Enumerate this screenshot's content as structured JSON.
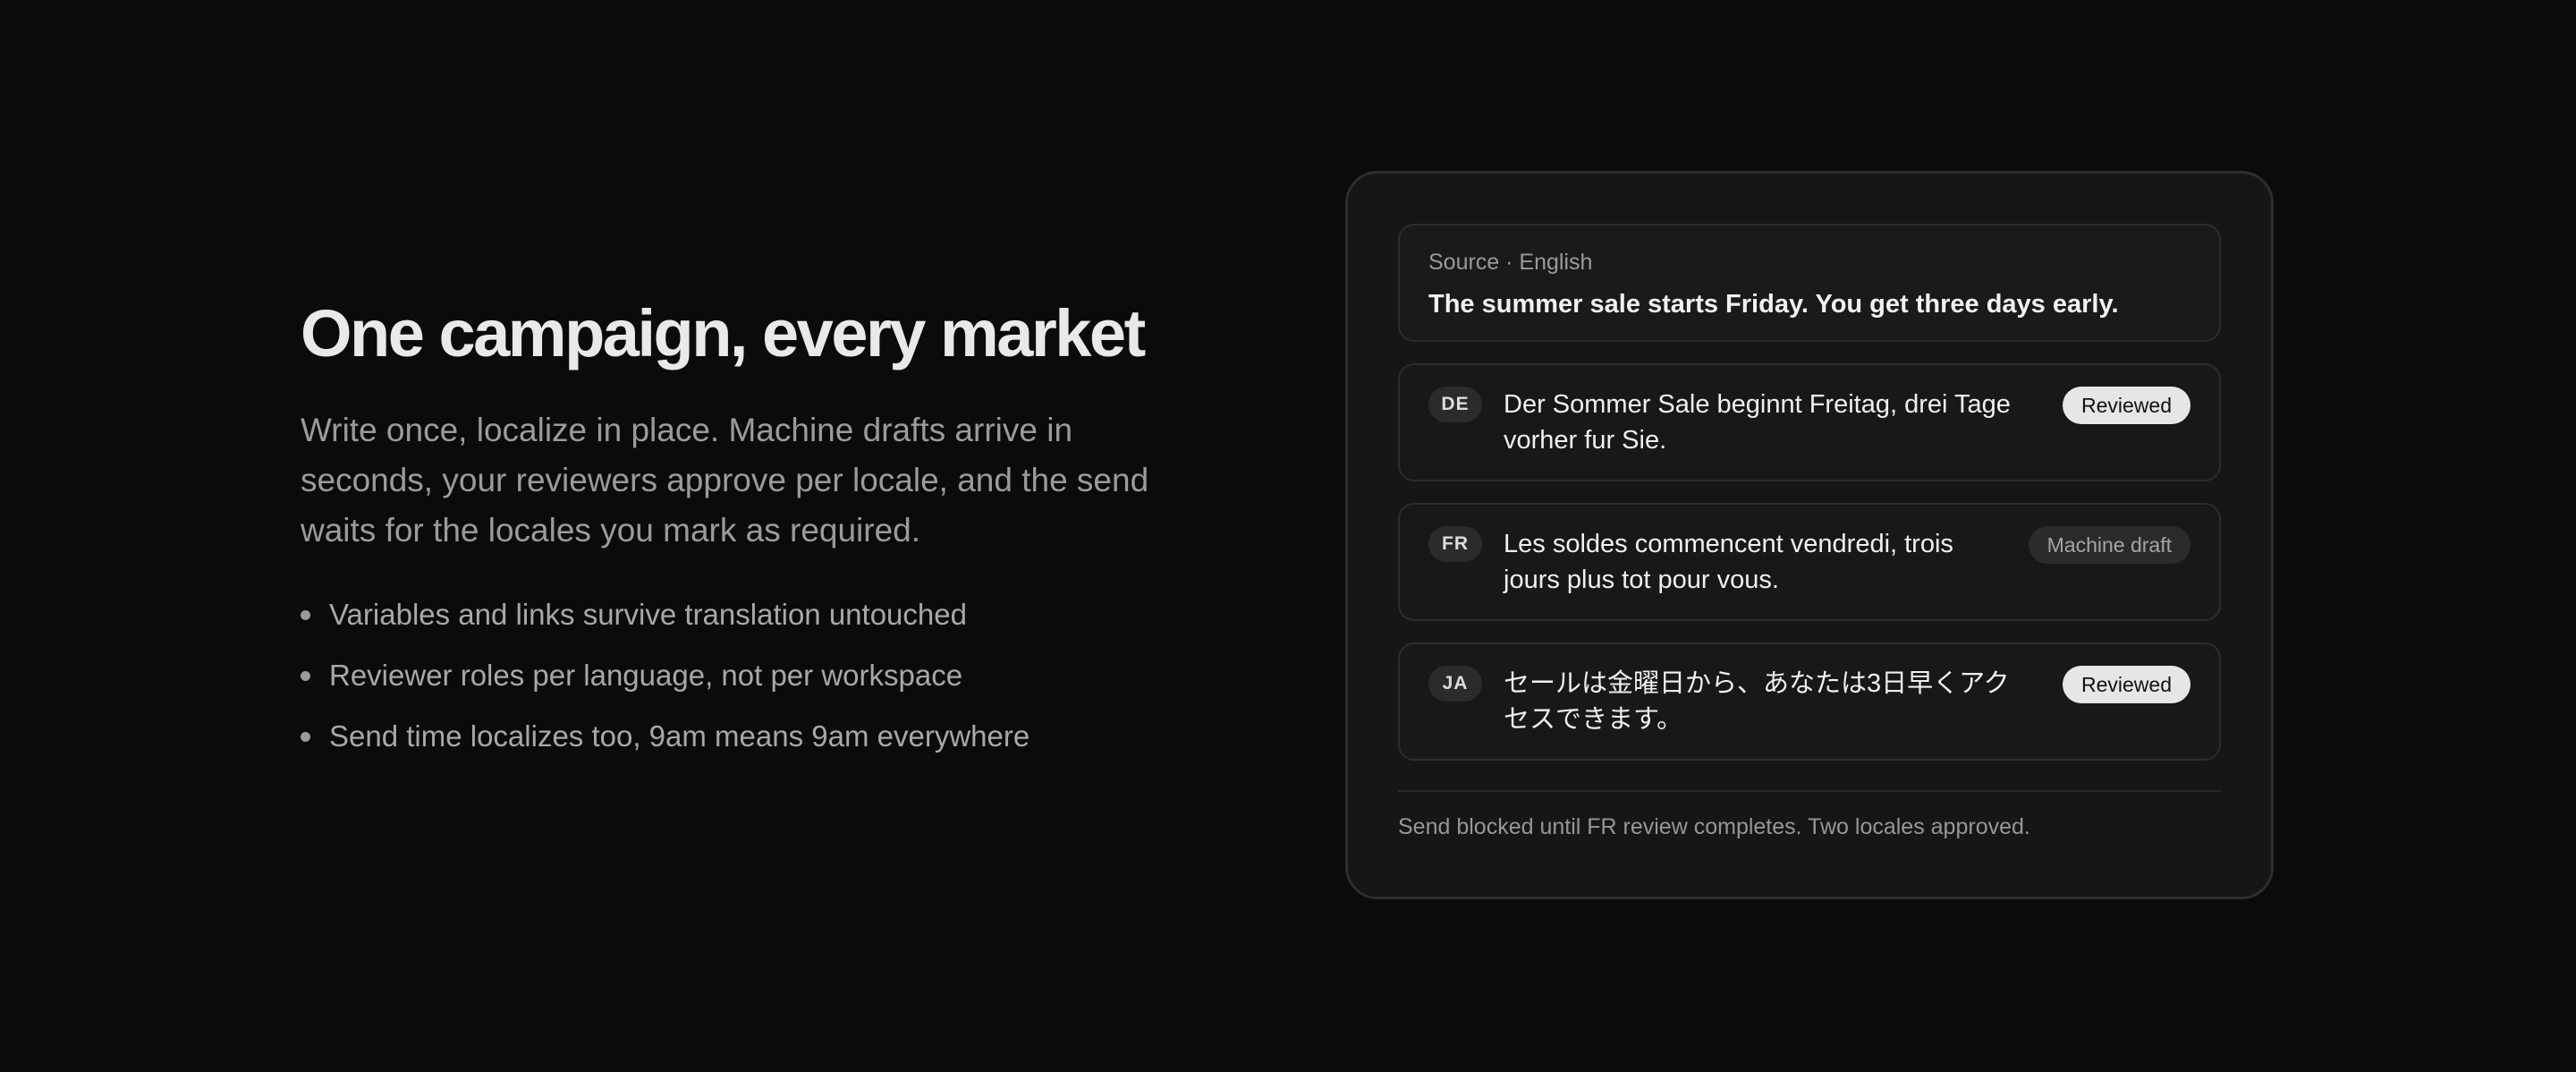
{
  "hero": {
    "title": "One campaign, every market",
    "subtitle": "Write once, localize in place. Machine drafts arrive in seconds, your reviewers approve per locale, and the send waits for the locales you mark as required.",
    "bullets": [
      "Variables and links survive translation untouched",
      "Reviewer roles per language, not per workspace",
      "Send time localizes too, 9am means 9am everywhere"
    ]
  },
  "card": {
    "source": {
      "label": "Source · English",
      "text": "The summer sale starts Friday. You get three days early."
    },
    "locales": [
      {
        "code": "DE",
        "text": "Der Sommer Sale beginnt Freitag, drei Tage vorher fur Sie.",
        "status": "Reviewed"
      },
      {
        "code": "FR",
        "text": "Les soldes commencent vendredi, trois jours plus tot pour vous.",
        "status": "Machine draft"
      },
      {
        "code": "JA",
        "text": "セールは金曜日から、あなたは3日早くアクセスできます。",
        "status": "Reviewed"
      }
    ],
    "footer": "Send blocked until FR review completes. Two locales approved."
  },
  "colors": {
    "background": "#0b0b0b",
    "card": "#161616",
    "reviewed_pill": "#e6e6e6",
    "draft_pill": "#2b2b2b"
  }
}
